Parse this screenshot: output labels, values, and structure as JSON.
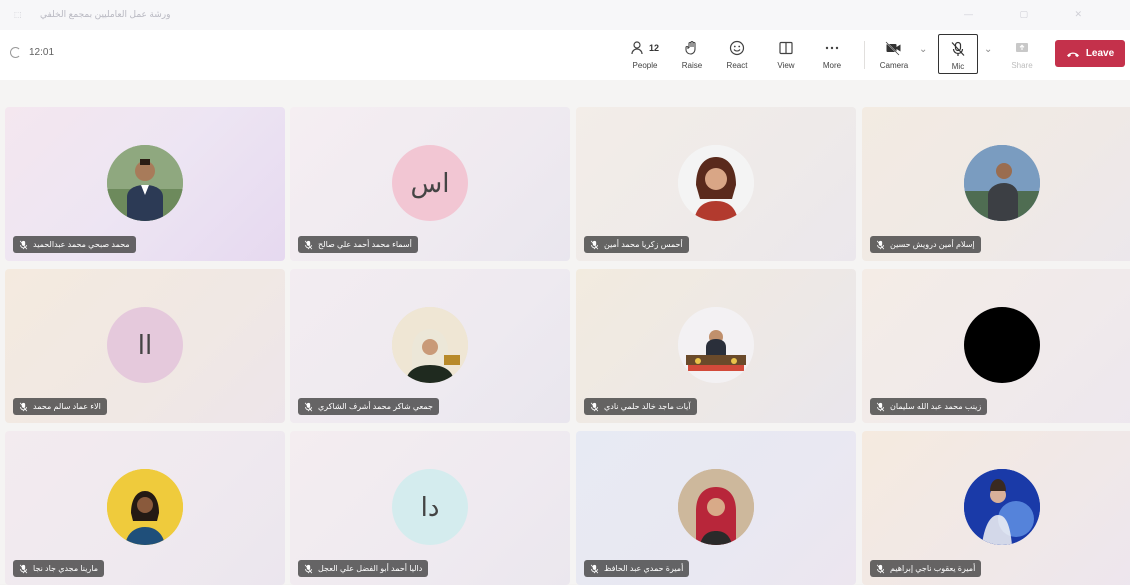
{
  "window": {
    "title": "ورشة عمل العامليين بمجمع الخلفي"
  },
  "toolbar": {
    "timer": "12:01",
    "people": {
      "label": "People",
      "count": "12"
    },
    "raise": {
      "label": "Raise"
    },
    "react": {
      "label": "React"
    },
    "view": {
      "label": "View"
    },
    "more": {
      "label": "More"
    },
    "camera": {
      "label": "Camera"
    },
    "mic": {
      "label": "Mic"
    },
    "share": {
      "label": "Share"
    },
    "leave": {
      "label": "Leave"
    }
  },
  "colors": {
    "leave": "#c4314b",
    "accent": "#6264a7"
  },
  "participants": [
    {
      "name": "محمد صبحي محمد عبدالحميد",
      "avatar": "photo-man-suit"
    },
    {
      "name": "أسماء محمد أحمد علي صالح",
      "avatar": "initials",
      "initials": "اس"
    },
    {
      "name": "أحمس زكريا محمد أمين",
      "avatar": "photo-woman"
    },
    {
      "name": "إسلام أمين درويش حسين",
      "avatar": "photo-man-outdoor"
    },
    {
      "name": "الاء عماد سالم محمد",
      "avatar": "initials",
      "initials": "اا"
    },
    {
      "name": "جمعي شاكر محمد أشرف الشاكري",
      "avatar": "photo-hijab"
    },
    {
      "name": "آيات ماجد خالد حلمي نادي",
      "avatar": "photo-conference"
    },
    {
      "name": "زينب محمد عبد الله سليمان",
      "avatar": "black"
    },
    {
      "name": "مارينا مجدي جاد نجا",
      "avatar": "photo-woman-yellow"
    },
    {
      "name": "داليا أحمد أبو الفضل علي العجل",
      "avatar": "initials",
      "initials": "دا"
    },
    {
      "name": "أميرة حمدي عبد الحافظ",
      "avatar": "photo-hijab-red"
    },
    {
      "name": "أميرة يعقوب ناجي إبراهيم",
      "avatar": "photo-blue"
    }
  ]
}
